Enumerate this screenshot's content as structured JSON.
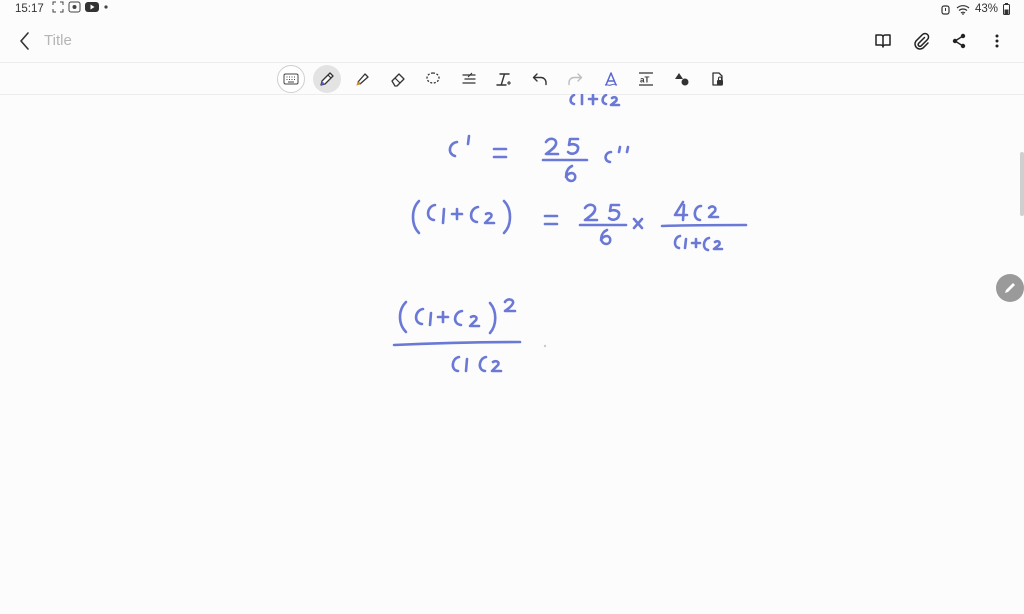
{
  "status_bar": {
    "time": "15:17",
    "battery": "43%",
    "icons_left": [
      "screenshot-icon",
      "screen-capture-icon",
      "youtube-icon",
      "dot-icon"
    ],
    "icons_right": [
      "alarm-icon",
      "wifi-icon",
      "battery-icon"
    ]
  },
  "header": {
    "title_placeholder": "Title",
    "actions": [
      "book-icon",
      "attachment-icon",
      "share-icon",
      "more-vert-icon"
    ]
  },
  "toolbar": {
    "tools": [
      "keyboard",
      "pen",
      "highlighter",
      "eraser",
      "lasso",
      "text-format",
      "straighten",
      "undo",
      "redo",
      "handwriting-to-text",
      "text-box",
      "shapes",
      "lock-page"
    ],
    "active_tool": "pen"
  },
  "colors": {
    "ink": "#6a79d6",
    "accent": "#c98a2a"
  }
}
